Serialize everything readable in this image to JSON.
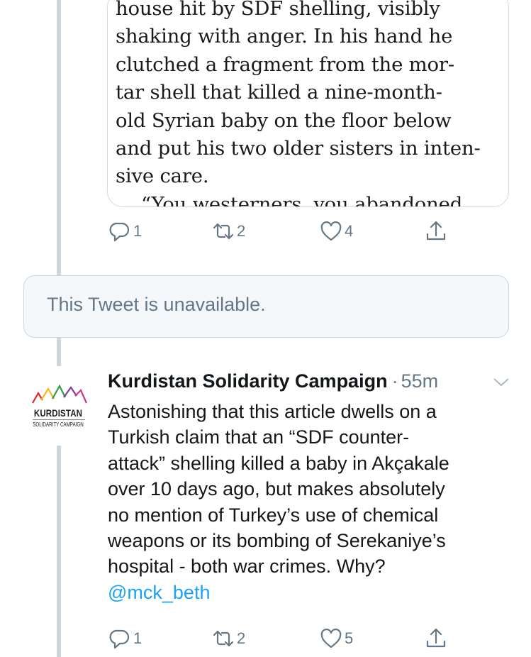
{
  "quoted_article": {
    "lines": [
      "house hit by SDF shelling, visibly",
      "shaking with anger. In his hand he",
      "clutched a fragment from the mor-",
      "tar shell that killed a nine-month-",
      "old Syrian baby on the floor below",
      "and put his two older sisters in inten-",
      "sive care.",
      "“You westerners, you abandoned"
    ]
  },
  "first_tweet_actions": {
    "reply_count": "1",
    "retweet_count": "2",
    "like_count": "4"
  },
  "unavailable": {
    "text": "This Tweet is unavailable."
  },
  "tweet": {
    "author": "Kurdistan Solidarity Campaign",
    "separator": "·",
    "time": "55m",
    "avatar_logo": {
      "name": "KURDISTAN",
      "sub": "SOLIDARITY CAMPAIGN",
      "colors": [
        "#e3262d",
        "#f7b718",
        "#2f9e44",
        "#7b3f98",
        "#d63384"
      ]
    },
    "body_lines": [
      "Astonishing that this article dwells on a",
      "Turkish claim that an “SDF counter-",
      "attack” shelling killed a baby in Akçakale",
      "over 10 days ago, but makes absolutely",
      "no mention of Turkey’s use of chemical",
      "weapons or its bombing of Serekaniye’s",
      "hospital - both war crimes. Why?"
    ],
    "mention": "@mck_beth",
    "reply_count": "1",
    "retweet_count": "2",
    "like_count": "5"
  },
  "colors": {
    "link": "#1da1f2",
    "secondary_text": "#657786",
    "thread_line": "#ccd6dd",
    "unavailable_bg": "#f5f8fa"
  },
  "icons": [
    "reply-icon",
    "retweet-icon",
    "like-icon",
    "share-icon",
    "chevron-down-icon"
  ]
}
